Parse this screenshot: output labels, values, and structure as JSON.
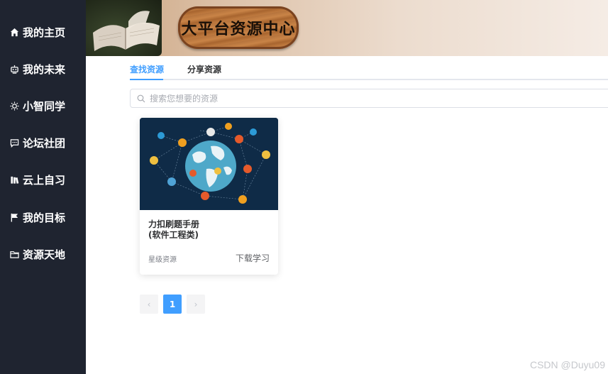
{
  "sidebar": {
    "items": [
      {
        "label": "我的主页",
        "icon": "home-icon"
      },
      {
        "label": "我的未来",
        "icon": "robot-icon"
      },
      {
        "label": "小智同学",
        "icon": "sun-icon"
      },
      {
        "label": "论坛社团",
        "icon": "chat-icon"
      },
      {
        "label": "云上自习",
        "icon": "books-icon"
      },
      {
        "label": "我的目标",
        "icon": "flag-icon"
      },
      {
        "label": "资源天地",
        "icon": "folder-icon"
      }
    ]
  },
  "banner": {
    "title": "大平台资源中心"
  },
  "tabs": [
    {
      "label": "查找资源",
      "active": true
    },
    {
      "label": "分享资源",
      "active": false
    }
  ],
  "search": {
    "placeholder": "搜索您想要的资源",
    "value": ""
  },
  "cards": [
    {
      "title": "力扣刷题手册\n(软件工程类)",
      "tag": "星级资源",
      "action": "下载学习"
    }
  ],
  "pagination": {
    "prev": "‹",
    "current": "1",
    "next": "›"
  },
  "watermark": "CSDN @Duyu09",
  "colors": {
    "sidebar": "#1f2430",
    "accent": "#409eff"
  }
}
